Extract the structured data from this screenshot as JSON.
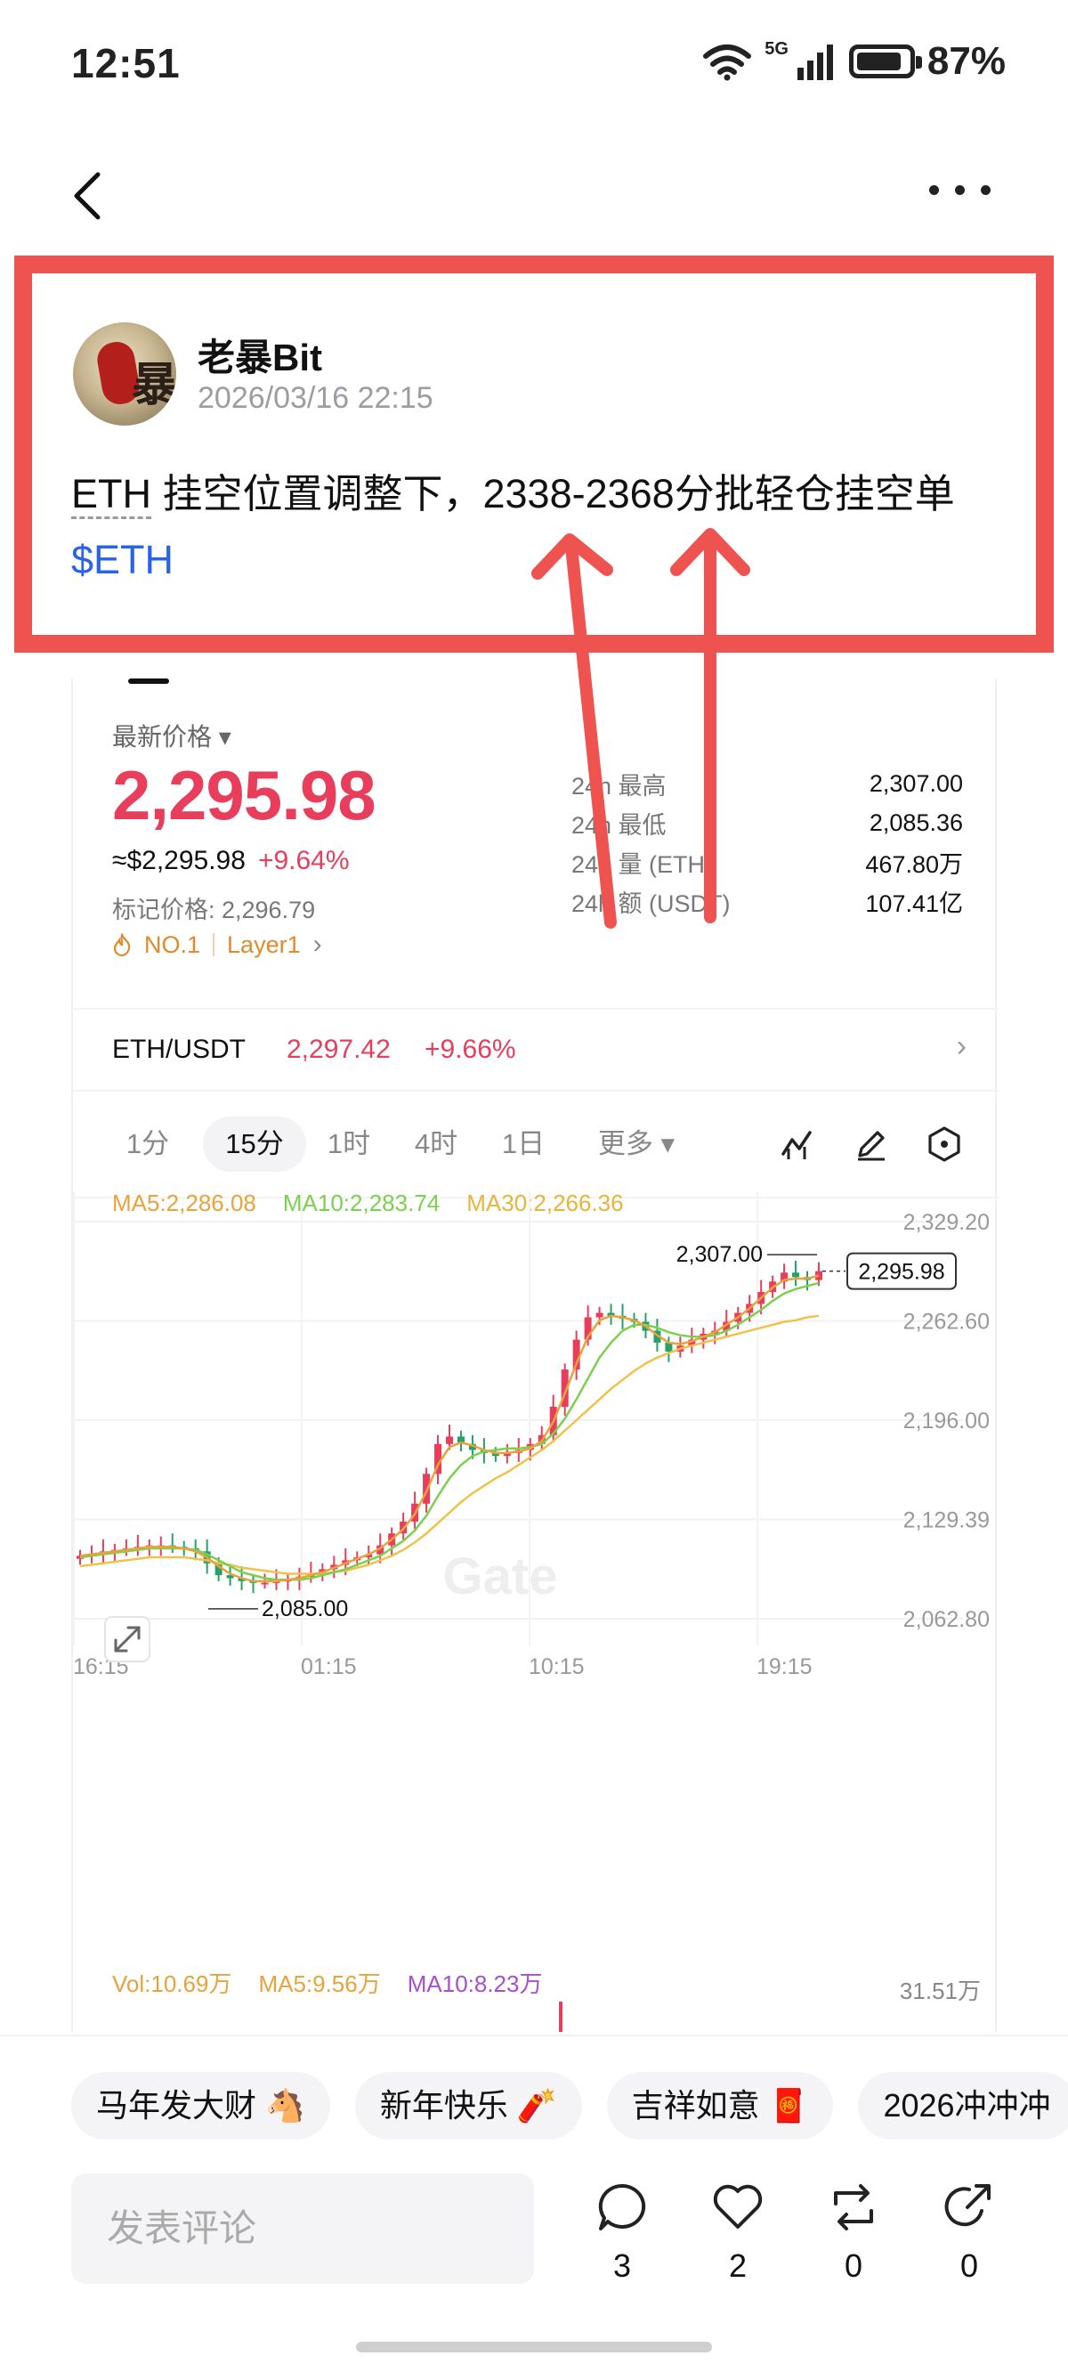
{
  "status_bar": {
    "time": "12:51",
    "network": "5G",
    "battery": "87%",
    "battery_level": 0.87
  },
  "post": {
    "author": "老暴Bit",
    "timestamp": "2026/03/16 22:15",
    "text_ticker": "ETH",
    "text_body": " 挂空位置调整下，2338-2368分批轻仓挂空单",
    "cashtag": "$ETH"
  },
  "market": {
    "latest_label": "最新价格 ▾",
    "latest_price": "2,295.98",
    "usd_price": "≈$2,295.98",
    "change_pct": "+9.64%",
    "mark_price": "标记价格: 2,296.79",
    "rank": "NO.1",
    "category": "Layer1",
    "stats": [
      {
        "label": "24h  最高",
        "value": "2,307.00"
      },
      {
        "label": "24h  最低",
        "value": "2,085.36"
      },
      {
        "label": "24h  量 (ETH)",
        "value": "467.80万"
      },
      {
        "label": "24h  额 (USDT)",
        "value": "107.41亿"
      }
    ],
    "pair": {
      "name": "ETH/USDT",
      "price": "2,297.42",
      "change": "+9.66%"
    },
    "intervals": [
      "1分",
      "15分",
      "1时",
      "4时",
      "1日",
      "更多 ▾"
    ],
    "active_interval": "15分"
  },
  "chart_data": {
    "type": "candlestick",
    "y_ticks": [
      "2,329.20",
      "2,262.60",
      "2,196.00",
      "2,129.39",
      "2,062.80"
    ],
    "ylim": [
      2062.8,
      2329.2
    ],
    "x_ticks": [
      "16:15",
      "01:15",
      "10:15",
      "19:15"
    ],
    "ma_legend": {
      "ma5": "MA5:2,286.08",
      "ma10": "MA10:2,283.74",
      "ma30": "MA30:2,266.36"
    },
    "high_label": "2,307.00",
    "low_label": "2,085.00",
    "last_price_label": "2,295.98",
    "series_close": [
      2105,
      2106,
      2108,
      2109,
      2110,
      2111,
      2112,
      2112,
      2111,
      2110,
      2108,
      2100,
      2092,
      2090,
      2088,
      2087,
      2087,
      2088,
      2089,
      2091,
      2093,
      2096,
      2099,
      2102,
      2104,
      2106,
      2112,
      2120,
      2128,
      2140,
      2160,
      2180,
      2185,
      2180,
      2176,
      2174,
      2172,
      2174,
      2176,
      2180,
      2186,
      2205,
      2230,
      2250,
      2265,
      2268,
      2266,
      2264,
      2262,
      2256,
      2248,
      2242,
      2246,
      2250,
      2254,
      2256,
      2262,
      2268,
      2274,
      2282,
      2289,
      2295,
      2292,
      2290,
      2296
    ],
    "ma5": [
      2105,
      2106,
      2107,
      2108,
      2109,
      2110,
      2111,
      2111,
      2111,
      2110,
      2108,
      2104,
      2098,
      2093,
      2090,
      2088,
      2088,
      2088,
      2089,
      2090,
      2092,
      2094,
      2097,
      2100,
      2103,
      2106,
      2110,
      2116,
      2123,
      2133,
      2148,
      2166,
      2178,
      2181,
      2179,
      2176,
      2174,
      2174,
      2175,
      2177,
      2182,
      2195,
      2214,
      2234,
      2252,
      2263,
      2266,
      2265,
      2263,
      2259,
      2253,
      2248,
      2247,
      2249,
      2252,
      2255,
      2260,
      2265,
      2271,
      2278,
      2285,
      2290,
      2291,
      2291,
      2293
    ],
    "ma10": [
      2104,
      2105,
      2106,
      2107,
      2108,
      2109,
      2110,
      2110,
      2110,
      2110,
      2109,
      2106,
      2102,
      2098,
      2094,
      2092,
      2090,
      2089,
      2089,
      2089,
      2090,
      2092,
      2094,
      2096,
      2099,
      2102,
      2105,
      2110,
      2115,
      2122,
      2132,
      2145,
      2157,
      2166,
      2172,
      2175,
      2176,
      2177,
      2177,
      2178,
      2180,
      2187,
      2197,
      2210,
      2224,
      2238,
      2248,
      2256,
      2260,
      2260,
      2258,
      2255,
      2253,
      2252,
      2252,
      2253,
      2256,
      2260,
      2265,
      2270,
      2276,
      2281,
      2284,
      2286,
      2288
    ],
    "ma30": [
      2098,
      2099,
      2100,
      2101,
      2102,
      2103,
      2104,
      2104,
      2104,
      2104,
      2103,
      2102,
      2100,
      2099,
      2097,
      2096,
      2095,
      2094,
      2093,
      2093,
      2093,
      2093,
      2094,
      2095,
      2097,
      2099,
      2102,
      2105,
      2109,
      2114,
      2120,
      2127,
      2134,
      2141,
      2147,
      2152,
      2157,
      2161,
      2166,
      2171,
      2176,
      2182,
      2189,
      2196,
      2203,
      2210,
      2217,
      2223,
      2229,
      2234,
      2238,
      2241,
      2244,
      2246,
      2248,
      2250,
      2252,
      2254,
      2256,
      2258,
      2260,
      2262,
      2263,
      2265,
      2266
    ]
  },
  "volume": {
    "vol": "Vol:10.69万",
    "ma5": "MA5:9.56万",
    "ma10": "MA10:8.23万",
    "axis_max": "31.51万"
  },
  "watermark": "Gate",
  "bottom": {
    "tags": [
      "马年发大财 🐴",
      "新年快乐 🧨",
      "吉祥如意 🧧",
      "2026冲冲冲"
    ],
    "comment_placeholder": "发表评论",
    "counts": {
      "comments": "3",
      "likes": "2",
      "reposts": "0",
      "shares": "0"
    }
  },
  "colors": {
    "up": "#e83e5c",
    "down": "#27a169",
    "ma5": "#e8a33d",
    "ma10": "#7bd04f",
    "ma30": "#f0c24a",
    "highlight": "#ef5350",
    "link": "#2a62e8"
  }
}
